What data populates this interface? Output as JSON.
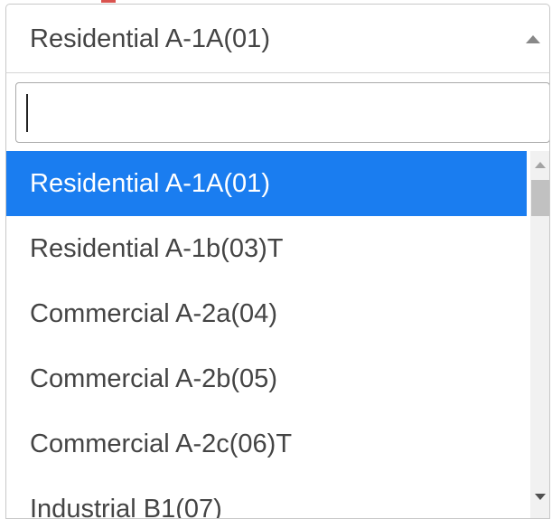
{
  "select": {
    "value": "Residential A-1A(01)",
    "arrow_icon": "caret-up-icon"
  },
  "search": {
    "value": "",
    "placeholder": ""
  },
  "options": [
    {
      "label": "Residential A-1A(01)",
      "selected": true
    },
    {
      "label": "Residential A-1b(03)T",
      "selected": false
    },
    {
      "label": "Commercial A-2a(04)",
      "selected": false
    },
    {
      "label": "Commercial A-2b(05)",
      "selected": false
    },
    {
      "label": "Commercial A-2c(06)T",
      "selected": false
    },
    {
      "label": "Industrial B1(07)",
      "selected": false
    }
  ],
  "colors": {
    "highlight": "#1a7df0",
    "text": "#444444",
    "border": "#c8c8c8",
    "required_mark": "#d9534f"
  }
}
